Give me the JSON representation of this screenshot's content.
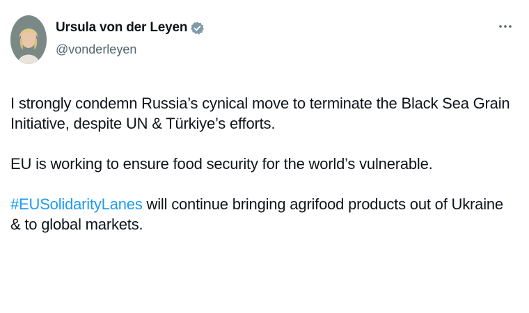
{
  "author": {
    "display_name": "Ursula von der Leyen",
    "handle": "@vonderleyen",
    "verified_icon": "verified-badge-icon",
    "more_icon": "more-options-icon"
  },
  "tweet": {
    "para1": "I strongly condemn Russia’s cynical move to terminate the Black Sea Grain Initiative, despite UN & Türkiye’s efforts.",
    "para2": "EU is working to ensure food security for the world’s vulnerable.",
    "hashtag": "#EUSolidarityLanes",
    "para3_rest": " will continue bringing agrifood products out of Ukraine & to global markets."
  },
  "colors": {
    "text": "#0f1419",
    "secondary": "#536471",
    "link": "#1d9bf0",
    "verified": "#829aab"
  }
}
